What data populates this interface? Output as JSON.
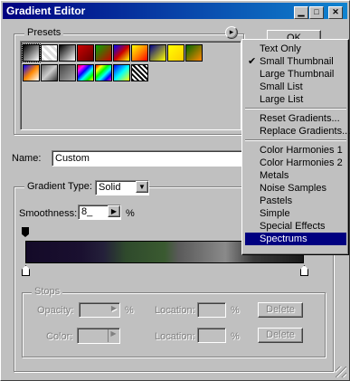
{
  "window": {
    "title": "Gradient Editor"
  },
  "presets": {
    "label": "Presets",
    "menu_button_glyph": "▸",
    "swatches": [
      "linear-gradient(135deg,#000,#fff)",
      "repeating-linear-gradient(45deg,#ddd 0 3px,#fff 3px 6px)",
      "linear-gradient(135deg,#000,#999 60%,#fff)",
      "linear-gradient(135deg,#c00,#600)",
      "linear-gradient(135deg,#0a0,#c00)",
      "linear-gradient(135deg,#00f,#c00,#ff0)",
      "linear-gradient(135deg,#ff0,#f80,#f00)",
      "linear-gradient(135deg,#008,#ff0)",
      "linear-gradient(135deg,#ff0,#fc0)",
      "linear-gradient(135deg,#060,#f80)",
      "linear-gradient(135deg,#00f,#f80,#fff)",
      "linear-gradient(135deg,#666,#ccc,#333)",
      "linear-gradient(135deg,#444,#aaa)",
      "linear-gradient(135deg,#f00,#f0f,#00f,#0ff,#0f0,#ff0)",
      "linear-gradient(135deg,#f00,#ff0,#0f0,#0ff,#00f,#f0f)",
      "linear-gradient(135deg,#00f,#0ff,#ff0)",
      "repeating-linear-gradient(45deg,#000 0 2px,#fff 2px 4px)"
    ]
  },
  "ok_label": "OK",
  "name": {
    "label": "Name:",
    "value": "Custom"
  },
  "gradient": {
    "group_label": "Gradient Type:",
    "type_value": "Solid",
    "smoothness_label": "Smoothness:",
    "smoothness_value": "8_",
    "percent": "%",
    "bar": "linear-gradient(90deg,#140a28 0%,#1a1030 20%,#24203a 28%,#2f4a2c 36%,#3a5a30 50%,#5a5a5a 55%,#8a8a8a 72%,#3a3a3a 82%,#1a1a1a 100%)"
  },
  "stops": {
    "label": "Stops",
    "opacity_label": "Opacity:",
    "color_label": "Color:",
    "location_label": "Location:",
    "percent": "%",
    "delete_label": "Delete"
  },
  "menu": {
    "check_glyph": "✔",
    "items": [
      {
        "label": "Text Only"
      },
      {
        "label": "Small Thumbnail",
        "checked": true
      },
      {
        "label": "Large Thumbnail"
      },
      {
        "label": "Small List"
      },
      {
        "label": "Large List"
      },
      {
        "sep": true
      },
      {
        "label": "Reset Gradients..."
      },
      {
        "label": "Replace Gradients..."
      },
      {
        "sep": true
      },
      {
        "label": "Color Harmonies 1"
      },
      {
        "label": "Color Harmonies 2"
      },
      {
        "label": "Metals"
      },
      {
        "label": "Noise Samples"
      },
      {
        "label": "Pastels"
      },
      {
        "label": "Simple"
      },
      {
        "label": "Special Effects"
      },
      {
        "label": "Spectrums",
        "highlighted": true
      }
    ]
  }
}
